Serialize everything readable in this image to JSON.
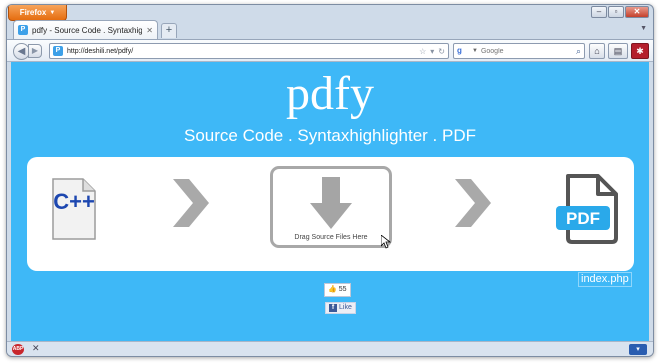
{
  "browser": {
    "menu_label": "Firefox",
    "tab_title": "pdfy - Source Code . Syntaxhighlight...",
    "url": "http://deshili.net/pdfy/",
    "search_placeholder": "Google",
    "window_buttons": [
      "minimize",
      "maximize",
      "close"
    ]
  },
  "page": {
    "title": "pdfy",
    "subtitle": "Source Code . Syntaxhighlighter . PDF",
    "dropzone_label": "Drag Source Files Here",
    "cpp_label": "C++",
    "pdf_label": "PDF",
    "file_name": "index.php",
    "like_count": "55",
    "like_label": "Like"
  },
  "colors": {
    "page_background": "#3eb8f7",
    "panel_background": "#ffffff",
    "accent_gray": "#a8a8a8",
    "pdf_blue": "#2aa9ea",
    "firefox_orange": "#e56d10"
  },
  "icons": [
    "firefox-menu-icon",
    "back-icon",
    "forward-icon",
    "site-favicon",
    "bookmark-star-icon",
    "reload-icon",
    "google-icon",
    "search-icon",
    "home-icon",
    "bookmarks-icon",
    "addon-icon",
    "cpp-file-icon",
    "chevron-right-icon",
    "download-arrow-icon",
    "mouse-cursor-icon",
    "pdf-file-icon",
    "thumbs-up-icon",
    "facebook-icon",
    "adblock-icon"
  ]
}
